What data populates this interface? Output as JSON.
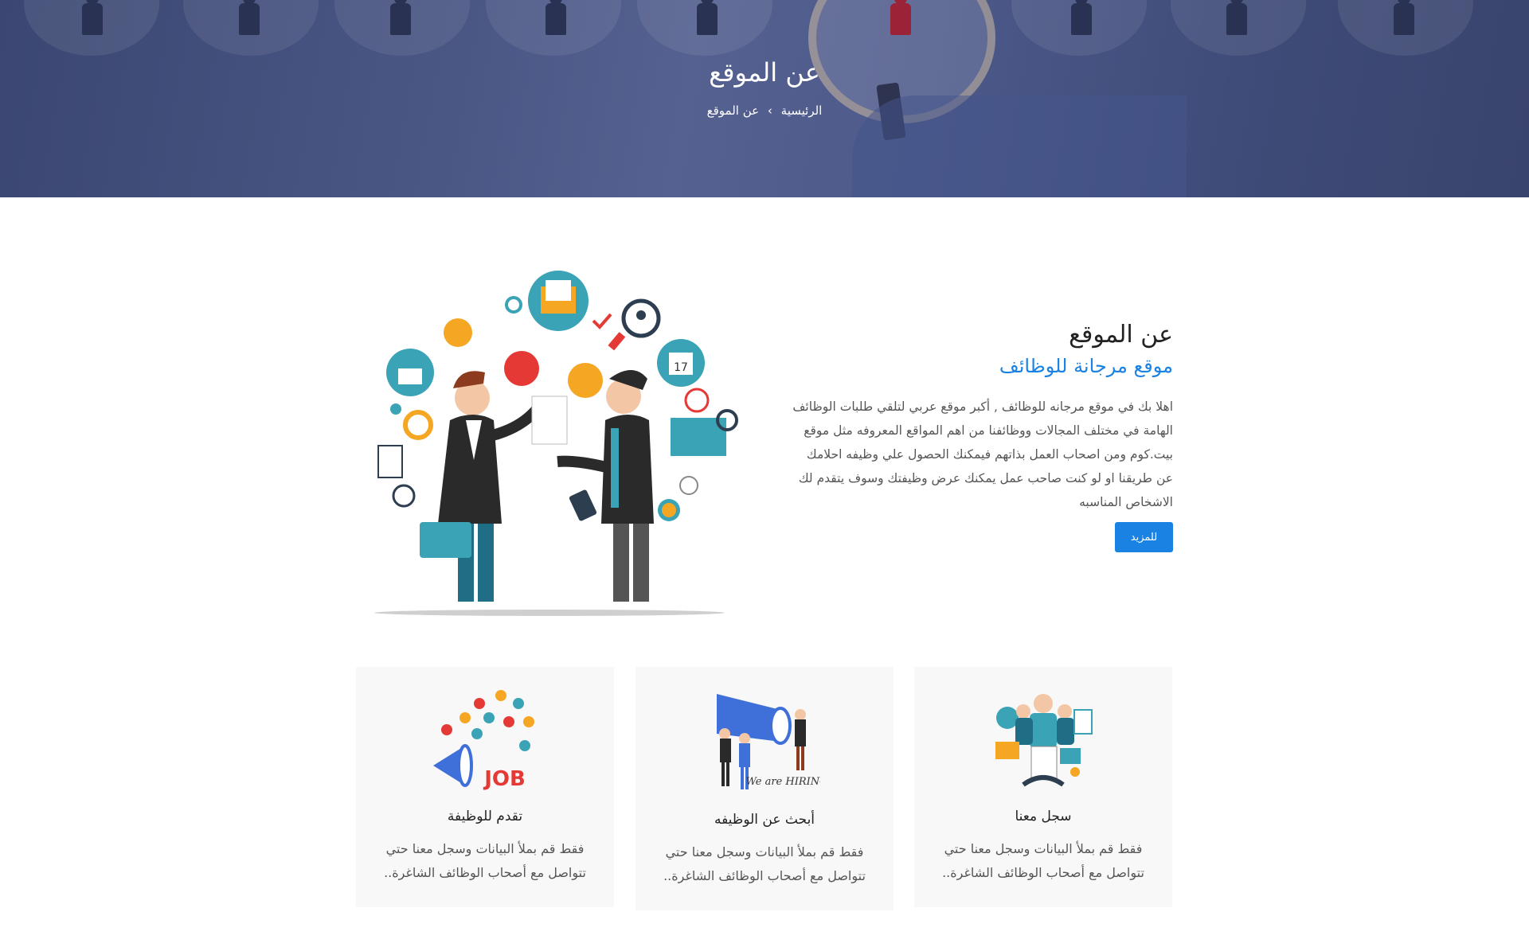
{
  "hero": {
    "title": "عن الموقع",
    "breadcrumb": {
      "home": "الرئيسية",
      "separator": "›",
      "current": "عن الموقع"
    }
  },
  "about": {
    "heading": "عن الموقع",
    "subheading": "موقع مرجانة للوظائف",
    "body": "اهلا بك في موقع مرجانه للوظائف , أكبر موقع عربي لتلقي طلبات الوظائف الهامة في مختلف المجالات ووظائفنا من اهم المواقع المعروفه مثل موقع بيت.كوم ومن اصحاب العمل بذاتهم فيمكنك الحصول علي وظيفه احلامك عن طريقنا او لو كنت صاحب عمل يمكنك عرض وظيفتك وسوف يتقدم لك الاشخاص المناسبه",
    "button_label": "للمزيد"
  },
  "cards": [
    {
      "title": "سجل معنا",
      "text": "فقط قم بملأ البيانات وسجل معنا حتي تتواصل مع أصحاب الوظائف الشاغرة..",
      "icon": "team-register-illustration"
    },
    {
      "title": "أبحث عن الوظيفه",
      "text": "فقط قم بملأ البيانات وسجل معنا حتي تتواصل مع أصحاب الوظائف الشاغرة..",
      "icon": "we-are-hiring-illustration",
      "image_text": "We are HIRING"
    },
    {
      "title": "تقدم للوظيفة",
      "text": "فقط قم بملأ البيانات وسجل معنا حتي تتواصل مع أصحاب الوظائف الشاغرة..",
      "icon": "job-megaphone-illustration",
      "image_text": "JOB"
    }
  ],
  "colors": {
    "accent": "#1a82e2",
    "hero_overlay": "#4a5684",
    "card_bg": "#f8f8f8"
  }
}
